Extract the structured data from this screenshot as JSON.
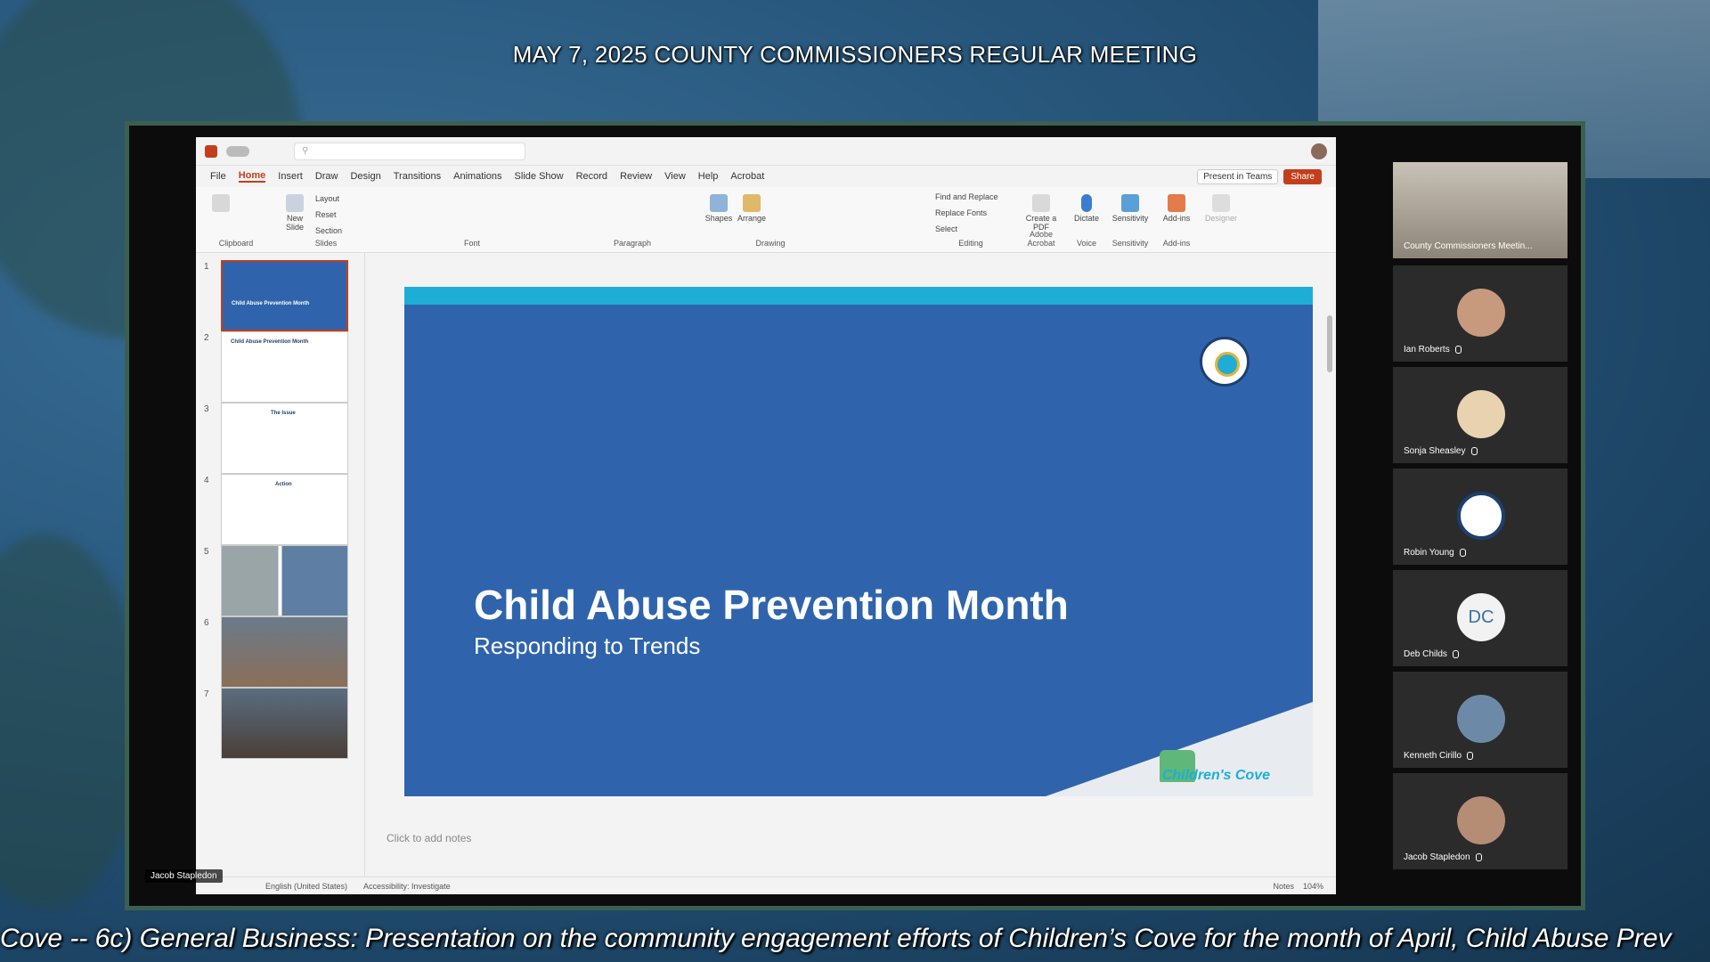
{
  "stream": {
    "title": "MAY 7, 2025 COUNTY COMMISSIONERS REGULAR MEETING",
    "ticker": "Cove -- 6c) General Business: Presentation on the community engagement efforts of Children’s Cove for the month of April, Child Abuse Prev"
  },
  "ppt": {
    "menu": [
      "File",
      "Home",
      "Insert",
      "Draw",
      "Design",
      "Transitions",
      "Animations",
      "Slide Show",
      "Record",
      "Review",
      "View",
      "Help",
      "Acrobat"
    ],
    "active_menu": "Home",
    "present_in_teams": "Present in Teams",
    "share": "Share",
    "ribbon": {
      "clipboard": "Clipboard",
      "new_slide": "New Slide",
      "layout": "Layout",
      "reset": "Reset",
      "section": "Section",
      "slides": "Slides",
      "font": "Font",
      "paragraph": "Paragraph",
      "shapes": "Shapes",
      "arrange": "Arrange",
      "drawing": "Drawing",
      "find_replace": "Find and Replace",
      "replace_fonts": "Replace Fonts",
      "select": "Select",
      "editing": "Editing",
      "create_pdf": "Create a PDF",
      "adobe_acrobat": "Adobe Acrobat",
      "dictate": "Dictate",
      "voice": "Voice",
      "sensitivity": "Sensitivity",
      "sensitivity_group": "Sensitivity",
      "addins": "Add-ins",
      "addins_group": "Add-ins",
      "designer": "Designer"
    },
    "thumbnails": [
      {
        "num": "1",
        "title": "Child Abuse Prevention Month"
      },
      {
        "num": "2",
        "title": "Child Abuse Prevention Month"
      },
      {
        "num": "3",
        "title": "The Issue"
      },
      {
        "num": "4",
        "title": "Action"
      },
      {
        "num": "5",
        "title": ""
      },
      {
        "num": "6",
        "title": ""
      },
      {
        "num": "7",
        "title": ""
      }
    ],
    "slide": {
      "title": "Child Abuse Prevention Month",
      "subtitle": "Responding to Trends",
      "logo_text": "Children's Cove"
    },
    "notes_placeholder": "Click to add notes",
    "status": {
      "language": "English (United States)",
      "accessibility": "Accessibility: Investigate",
      "notes": "Notes",
      "zoom": "104%"
    }
  },
  "presenter": "Jacob Stapledon",
  "participants": [
    {
      "name": "County Commissioners Meetin...",
      "kind": "room"
    },
    {
      "name": "Ian Roberts",
      "kind": "photo"
    },
    {
      "name": "Sonja Sheasley",
      "kind": "photo"
    },
    {
      "name": "Robin Young",
      "kind": "seal"
    },
    {
      "name": "Deb Childs",
      "kind": "initials",
      "initials": "DC"
    },
    {
      "name": "Kenneth Cirillo",
      "kind": "photo"
    },
    {
      "name": "Jacob Stapledon",
      "kind": "photo"
    }
  ],
  "colors": {
    "slide_blue": "#2f64ad",
    "slide_band": "#1eaed5",
    "ppt_accent": "#c43e1c"
  }
}
